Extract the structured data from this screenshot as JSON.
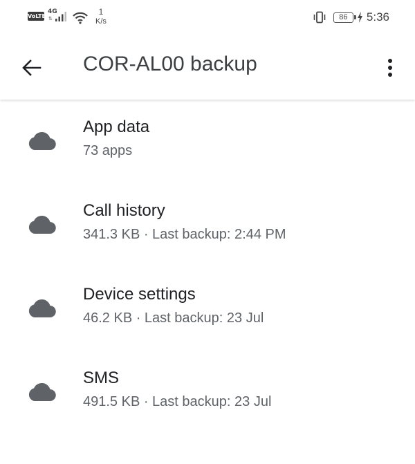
{
  "status_bar": {
    "volte": "VoLTE",
    "network": "4G",
    "speed_value": "1",
    "speed_unit": "K/s",
    "battery": "86",
    "time": "5:36",
    "icons": [
      "signal-icon",
      "wifi-icon",
      "vibrate-icon",
      "battery-icon",
      "charging-icon"
    ]
  },
  "app_bar": {
    "title": "COR-AL00 backup",
    "back_icon": "arrow-back-icon",
    "more_icon": "more-vert-icon"
  },
  "backup_items": [
    {
      "title": "App data",
      "subtitle": "73 apps",
      "icon": "cloud-icon"
    },
    {
      "title": "Call history",
      "subtitle": "341.3 KB · Last backup: 2:44 PM",
      "icon": "cloud-icon"
    },
    {
      "title": "Device settings",
      "subtitle": "46.2 KB · Last backup: 23 Jul",
      "icon": "cloud-icon"
    },
    {
      "title": "SMS",
      "subtitle": "491.5 KB · Last backup: 23 Jul",
      "icon": "cloud-icon"
    }
  ],
  "colors": {
    "icon_gray": "#5f6368",
    "title_text": "#202124",
    "subtitle_text": "#5f6368"
  }
}
